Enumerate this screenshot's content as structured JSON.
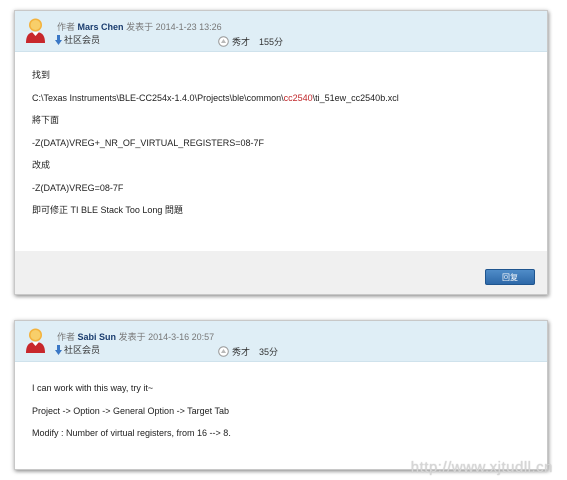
{
  "posts": [
    {
      "author_prefix": "作者",
      "author": "Mars Chen",
      "posted_prefix": "发表于",
      "date": "2014-1-23 13:26",
      "group": "社区会员",
      "rank": "秀才",
      "points": "155分",
      "body": {
        "line1": "找到",
        "path_pre": "C:\\Texas Instruments\\BLE-CC254x-1.4.0\\Projects\\ble\\common\\",
        "path_highlight": "cc2540",
        "path_post": "\\ti_51ew_cc2540b.xcl",
        "line3": "將下面",
        "line4": "-Z(DATA)VREG+_NR_OF_VIRTUAL_REGISTERS=08-7F",
        "line5": "改成",
        "line6": "-Z(DATA)VREG=08-7F",
        "line7": "即可修正 TI BLE Stack Too Long 問題"
      },
      "reply_label": "回复"
    },
    {
      "author_prefix": "作者",
      "author": "Sabi Sun",
      "posted_prefix": "发表于",
      "date": "2014-3-16 20:57",
      "group": "社区会员",
      "rank": "秀才",
      "points": "35分",
      "body": {
        "line1": "I can work with this way, try it~",
        "line2": "Project -> Option -> General Option -> Target Tab",
        "line3": "Modify : Number of virtual registers, from 16 --> 8."
      }
    }
  ],
  "watermark": "http://www.xjtudll.cn",
  "colors": {
    "header_bg": "#dfeef6",
    "author": "#1a3c6e",
    "highlight": "#c0262a",
    "reply_button": "#2d68a8"
  },
  "icons": [
    "avatar-icon",
    "member-badge-icon",
    "rank-icon"
  ]
}
